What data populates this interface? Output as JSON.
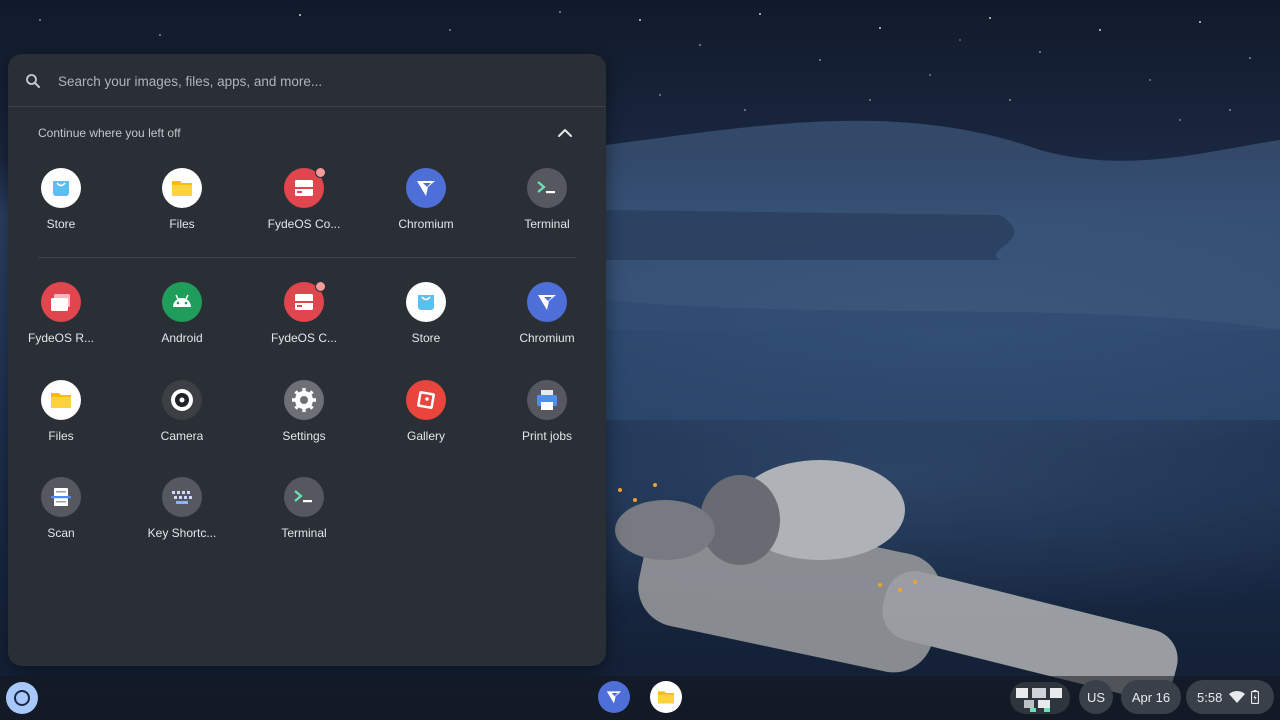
{
  "search": {
    "placeholder": "Search your images, files, apps, and more..."
  },
  "continue_section": {
    "title": "Continue where you left off",
    "items": [
      {
        "label": "Store",
        "icon": "store-icon"
      },
      {
        "label": "Files",
        "icon": "files-icon"
      },
      {
        "label": "FydeOS Co...",
        "icon": "fydeos-control-icon"
      },
      {
        "label": "Chromium",
        "icon": "chromium-icon"
      },
      {
        "label": "Terminal",
        "icon": "terminal-icon"
      }
    ]
  },
  "apps": [
    {
      "label": "FydeOS R...",
      "icon": "fydeos-remote-icon"
    },
    {
      "label": "Android",
      "icon": "android-icon"
    },
    {
      "label": "FydeOS C...",
      "icon": "fydeos-control-icon"
    },
    {
      "label": "Store",
      "icon": "store-icon"
    },
    {
      "label": "Chromium",
      "icon": "chromium-icon"
    },
    {
      "label": "Files",
      "icon": "files-icon"
    },
    {
      "label": "Camera",
      "icon": "camera-icon"
    },
    {
      "label": "Settings",
      "icon": "settings-icon"
    },
    {
      "label": "Gallery",
      "icon": "gallery-icon"
    },
    {
      "label": "Print jobs",
      "icon": "printer-icon"
    },
    {
      "label": "Scan",
      "icon": "scan-icon"
    },
    {
      "label": "Key Shortc...",
      "icon": "keyboard-icon"
    },
    {
      "label": "Terminal",
      "icon": "terminal-icon"
    }
  ],
  "shelf": {
    "pinned": [
      "chromium-icon",
      "files-icon"
    ],
    "ime": "US",
    "date": "Apr 16",
    "time": "5:58"
  },
  "colors": {
    "launcher_bg": "#2a2f36",
    "accent": "#a8c7fa",
    "chromium_blue": "#4f6fd8",
    "files_yellow": "#fbbc04",
    "fydeos_red": "#e0464e"
  }
}
